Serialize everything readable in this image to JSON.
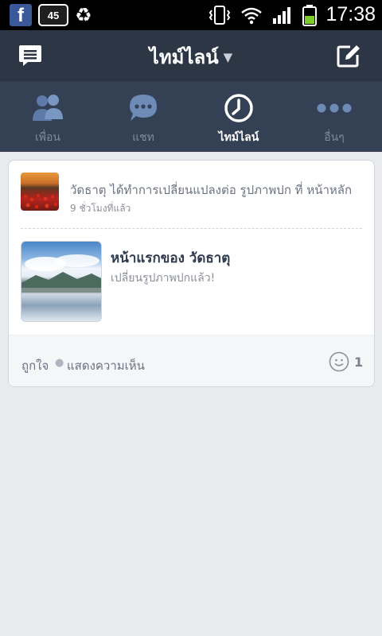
{
  "status_bar": {
    "time": "17:38",
    "battery_percent": "45",
    "fb_letter": "f",
    "icons": [
      "facebook-icon",
      "battery-percent-badge",
      "recycle-icon",
      "vibrate-icon",
      "wifi-icon",
      "signal-icon",
      "battery-icon"
    ]
  },
  "header": {
    "title": "ไทม์ไลน์",
    "left_icon": "message-icon",
    "right_icon": "compose-icon"
  },
  "tabs": [
    {
      "label": "เพื่อน",
      "icon": "friends-icon",
      "active": false
    },
    {
      "label": "แชท",
      "icon": "chat-icon",
      "active": false
    },
    {
      "label": "ไทม์ไลน์",
      "icon": "clock-icon",
      "active": true
    },
    {
      "label": "อื่นๆ",
      "icon": "more-icon",
      "active": false
    }
  ],
  "post": {
    "notification": "วัดธาตุ ได้ทำการเปลี่ยนแปลงต่อ รูปภาพปก ที่ หน้าหลัก",
    "time": "9 ชั่วโมงที่แล้ว",
    "title": "หน้าแรกของ วัดธาตุ",
    "subtitle": "เปลี่ยนรูปภาพปกแล้ว!",
    "like_label": "ถูกใจ",
    "comment_label": "แสดงความเห็น",
    "reaction_count": "1"
  },
  "colors": {
    "header_bg": "#2c3645",
    "tabbar_bg": "#344155",
    "page_bg": "#e9eaee",
    "title_text": "#2e3b4e"
  }
}
